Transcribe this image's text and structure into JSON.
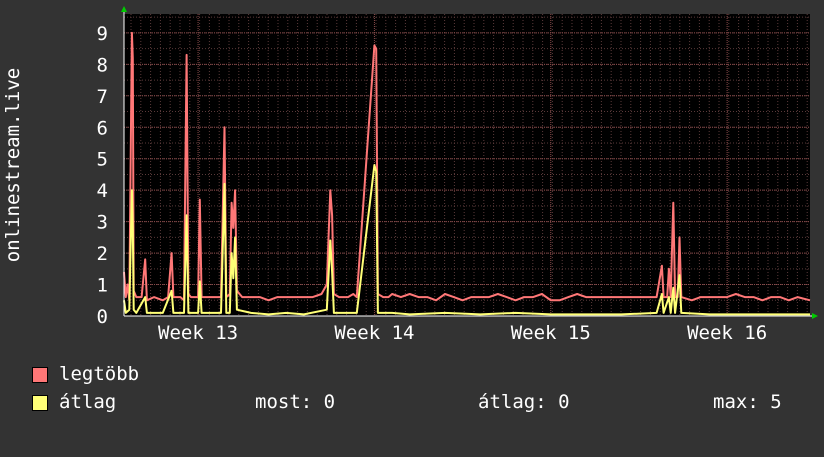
{
  "chart_data": {
    "type": "line",
    "ylabel": "onlinestream.live",
    "y_ticks": [
      "0",
      "1",
      "2",
      "3",
      "4",
      "5",
      "6",
      "7",
      "8",
      "9"
    ],
    "ylim": [
      0,
      9.6
    ],
    "x_ticks": [
      "Week 13",
      "Week 14",
      "Week 15",
      "Week 16"
    ],
    "x_tick_positions": [
      2.0,
      3.0,
      4.0,
      5.0
    ],
    "xlim": [
      1.58,
      5.47
    ],
    "grid": true,
    "colors": {
      "background": "#333333",
      "plot_background": "#000000",
      "grid": "#5a3a3a",
      "axis": "#ffffff",
      "arrow": "#00cc00"
    },
    "series": [
      {
        "name": "legtöbb",
        "color": "#ff7777",
        "points": [
          [
            1.58,
            1.4
          ],
          [
            1.59,
            0.6
          ],
          [
            1.6,
            1.0
          ],
          [
            1.61,
            0.5
          ],
          [
            1.625,
            9.0
          ],
          [
            1.63,
            8.2
          ],
          [
            1.635,
            0.8
          ],
          [
            1.65,
            0.6
          ],
          [
            1.68,
            0.6
          ],
          [
            1.7,
            1.8
          ],
          [
            1.71,
            0.5
          ],
          [
            1.75,
            0.6
          ],
          [
            1.8,
            0.5
          ],
          [
            1.83,
            0.6
          ],
          [
            1.85,
            2.0
          ],
          [
            1.86,
            0.6
          ],
          [
            1.9,
            0.6
          ],
          [
            1.92,
            0.5
          ],
          [
            1.935,
            8.3
          ],
          [
            1.945,
            0.7
          ],
          [
            1.96,
            0.6
          ],
          [
            1.98,
            0.6
          ],
          [
            2.0,
            0.6
          ],
          [
            2.01,
            3.7
          ],
          [
            2.02,
            0.6
          ],
          [
            2.04,
            0.6
          ],
          [
            2.07,
            0.6
          ],
          [
            2.1,
            0.6
          ],
          [
            2.13,
            0.6
          ],
          [
            2.15,
            6.0
          ],
          [
            2.16,
            0.6
          ],
          [
            2.18,
            0.7
          ],
          [
            2.19,
            3.6
          ],
          [
            2.2,
            2.8
          ],
          [
            2.21,
            4.0
          ],
          [
            2.22,
            0.8
          ],
          [
            2.25,
            0.6
          ],
          [
            2.3,
            0.6
          ],
          [
            2.35,
            0.6
          ],
          [
            2.4,
            0.5
          ],
          [
            2.45,
            0.6
          ],
          [
            2.5,
            0.6
          ],
          [
            2.55,
            0.6
          ],
          [
            2.6,
            0.6
          ],
          [
            2.65,
            0.6
          ],
          [
            2.7,
            0.7
          ],
          [
            2.73,
            1.0
          ],
          [
            2.75,
            4.0
          ],
          [
            2.76,
            3.2
          ],
          [
            2.77,
            0.7
          ],
          [
            2.8,
            0.6
          ],
          [
            2.85,
            0.6
          ],
          [
            2.88,
            0.7
          ],
          [
            2.9,
            0.6
          ],
          [
            3.0,
            8.6
          ],
          [
            3.01,
            8.5
          ],
          [
            3.02,
            0.7
          ],
          [
            3.05,
            0.6
          ],
          [
            3.08,
            0.6
          ],
          [
            3.1,
            0.7
          ],
          [
            3.15,
            0.6
          ],
          [
            3.2,
            0.7
          ],
          [
            3.25,
            0.6
          ],
          [
            3.3,
            0.6
          ],
          [
            3.35,
            0.5
          ],
          [
            3.4,
            0.7
          ],
          [
            3.45,
            0.6
          ],
          [
            3.5,
            0.5
          ],
          [
            3.55,
            0.6
          ],
          [
            3.6,
            0.6
          ],
          [
            3.65,
            0.6
          ],
          [
            3.7,
            0.7
          ],
          [
            3.75,
            0.6
          ],
          [
            3.8,
            0.5
          ],
          [
            3.85,
            0.6
          ],
          [
            3.9,
            0.6
          ],
          [
            3.95,
            0.7
          ],
          [
            4.0,
            0.5
          ],
          [
            4.05,
            0.5
          ],
          [
            4.1,
            0.6
          ],
          [
            4.15,
            0.7
          ],
          [
            4.2,
            0.6
          ],
          [
            4.25,
            0.6
          ],
          [
            4.3,
            0.6
          ],
          [
            4.35,
            0.6
          ],
          [
            4.4,
            0.6
          ],
          [
            4.45,
            0.6
          ],
          [
            4.5,
            0.6
          ],
          [
            4.55,
            0.6
          ],
          [
            4.6,
            0.6
          ],
          [
            4.63,
            1.6
          ],
          [
            4.64,
            0.6
          ],
          [
            4.66,
            0.6
          ],
          [
            4.67,
            1.5
          ],
          [
            4.68,
            0.6
          ],
          [
            4.695,
            3.6
          ],
          [
            4.705,
            0.6
          ],
          [
            4.72,
            0.6
          ],
          [
            4.73,
            2.5
          ],
          [
            4.74,
            0.6
          ],
          [
            4.8,
            0.5
          ],
          [
            4.85,
            0.6
          ],
          [
            4.9,
            0.6
          ],
          [
            4.95,
            0.6
          ],
          [
            5.0,
            0.6
          ],
          [
            5.05,
            0.7
          ],
          [
            5.1,
            0.6
          ],
          [
            5.15,
            0.6
          ],
          [
            5.2,
            0.5
          ],
          [
            5.25,
            0.6
          ],
          [
            5.3,
            0.6
          ],
          [
            5.35,
            0.5
          ],
          [
            5.4,
            0.6
          ],
          [
            5.47,
            0.5
          ]
        ]
      },
      {
        "name": "átlag",
        "color": "#ffff77",
        "points": [
          [
            1.58,
            0.5
          ],
          [
            1.59,
            0.1
          ],
          [
            1.61,
            0.2
          ],
          [
            1.625,
            4.0
          ],
          [
            1.63,
            2.8
          ],
          [
            1.635,
            0.2
          ],
          [
            1.65,
            0.1
          ],
          [
            1.7,
            0.6
          ],
          [
            1.71,
            0.1
          ],
          [
            1.8,
            0.1
          ],
          [
            1.85,
            0.8
          ],
          [
            1.86,
            0.1
          ],
          [
            1.92,
            0.1
          ],
          [
            1.935,
            3.2
          ],
          [
            1.945,
            0.1
          ],
          [
            2.0,
            0.1
          ],
          [
            2.01,
            1.1
          ],
          [
            2.02,
            0.1
          ],
          [
            2.13,
            0.1
          ],
          [
            2.15,
            4.2
          ],
          [
            2.16,
            0.1
          ],
          [
            2.18,
            0.1
          ],
          [
            2.19,
            2.0
          ],
          [
            2.2,
            1.2
          ],
          [
            2.21,
            2.5
          ],
          [
            2.22,
            0.2
          ],
          [
            2.3,
            0.1
          ],
          [
            2.4,
            0.05
          ],
          [
            2.5,
            0.1
          ],
          [
            2.6,
            0.05
          ],
          [
            2.73,
            0.2
          ],
          [
            2.75,
            2.4
          ],
          [
            2.76,
            1.4
          ],
          [
            2.77,
            0.1
          ],
          [
            2.9,
            0.1
          ],
          [
            3.0,
            4.8
          ],
          [
            3.01,
            4.6
          ],
          [
            3.02,
            0.1
          ],
          [
            3.1,
            0.1
          ],
          [
            3.2,
            0.05
          ],
          [
            3.4,
            0.1
          ],
          [
            3.6,
            0.05
          ],
          [
            3.8,
            0.1
          ],
          [
            4.0,
            0.05
          ],
          [
            4.2,
            0.05
          ],
          [
            4.4,
            0.05
          ],
          [
            4.6,
            0.1
          ],
          [
            4.63,
            0.7
          ],
          [
            4.64,
            0.1
          ],
          [
            4.67,
            0.6
          ],
          [
            4.68,
            0.1
          ],
          [
            4.695,
            0.9
          ],
          [
            4.705,
            0.1
          ],
          [
            4.73,
            1.3
          ],
          [
            4.74,
            0.1
          ],
          [
            4.9,
            0.05
          ],
          [
            5.1,
            0.05
          ],
          [
            5.3,
            0.05
          ],
          [
            5.47,
            0.05
          ]
        ]
      }
    ]
  },
  "legend": {
    "max_label": "legtöbb",
    "avg_label": "átlag"
  },
  "stats": {
    "current": "most: 0",
    "average": "átlag: 0",
    "maximum": "max: 5"
  }
}
